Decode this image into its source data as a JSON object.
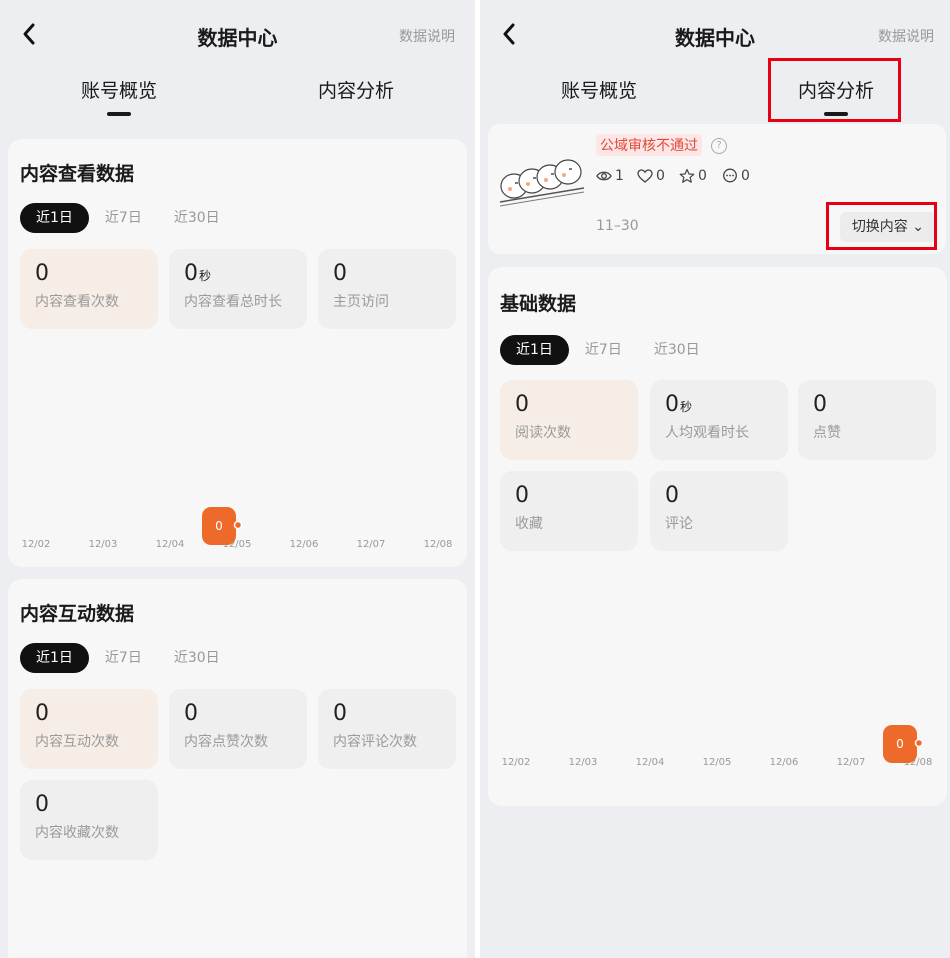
{
  "left": {
    "nav": {
      "title": "数据中心",
      "link": "数据说明"
    },
    "tabs": [
      {
        "label": "账号概览",
        "active": true
      },
      {
        "label": "内容分析",
        "active": false
      }
    ],
    "view_card": {
      "title": "内容查看数据",
      "segments": [
        "近1日",
        "近7日",
        "近30日"
      ],
      "metrics": [
        {
          "value": "0",
          "unit": "",
          "label": "内容查看次数"
        },
        {
          "value": "0",
          "unit": "秒",
          "label": "内容查看总时长"
        },
        {
          "value": "0",
          "unit": "",
          "label": "主页访问"
        }
      ],
      "chart_data": {
        "type": "line",
        "x": [
          "12/02",
          "12/03",
          "12/04",
          "12/05",
          "12/06",
          "12/07",
          "12/08"
        ],
        "values": [
          0,
          0,
          0,
          0,
          0,
          0,
          0
        ],
        "highlight_index": 3,
        "highlight_label": "0"
      }
    },
    "interact_card": {
      "title": "内容互动数据",
      "segments": [
        "近1日",
        "近7日",
        "近30日"
      ],
      "metrics": [
        {
          "value": "0",
          "unit": "",
          "label": "内容互动次数"
        },
        {
          "value": "0",
          "unit": "",
          "label": "内容点赞次数"
        },
        {
          "value": "0",
          "unit": "",
          "label": "内容评论次数"
        },
        {
          "value": "0",
          "unit": "",
          "label": "内容收藏次数"
        }
      ]
    }
  },
  "right": {
    "nav": {
      "title": "数据中心",
      "link": "数据说明"
    },
    "tabs": [
      {
        "label": "账号概览",
        "active": false
      },
      {
        "label": "内容分析",
        "active": true
      }
    ],
    "content": {
      "status": "公域审核不通过",
      "help": "?",
      "views": "1",
      "likes": "0",
      "stars": "0",
      "comments": "0",
      "date": "11–30",
      "switch_label": "切换内容 ⌄"
    },
    "basic_card": {
      "title": "基础数据",
      "segments": [
        "近1日",
        "近7日",
        "近30日"
      ],
      "metrics": [
        {
          "value": "0",
          "unit": "",
          "label": "阅读次数"
        },
        {
          "value": "0",
          "unit": "秒",
          "label": "人均观看时长"
        },
        {
          "value": "0",
          "unit": "",
          "label": "点赞"
        },
        {
          "value": "0",
          "unit": "",
          "label": "收藏"
        },
        {
          "value": "0",
          "unit": "",
          "label": "评论"
        }
      ],
      "chart_data": {
        "type": "line",
        "x": [
          "12/02",
          "12/03",
          "12/04",
          "12/05",
          "12/06",
          "12/07",
          "12/08"
        ],
        "values": [
          0,
          0,
          0,
          0,
          0,
          0,
          0
        ],
        "highlight_index": 6,
        "highlight_label": "0"
      }
    }
  },
  "colors": {
    "accent": "#ee6a2b",
    "highlight_box": "#e60012",
    "status_red": "#e24a3b"
  }
}
